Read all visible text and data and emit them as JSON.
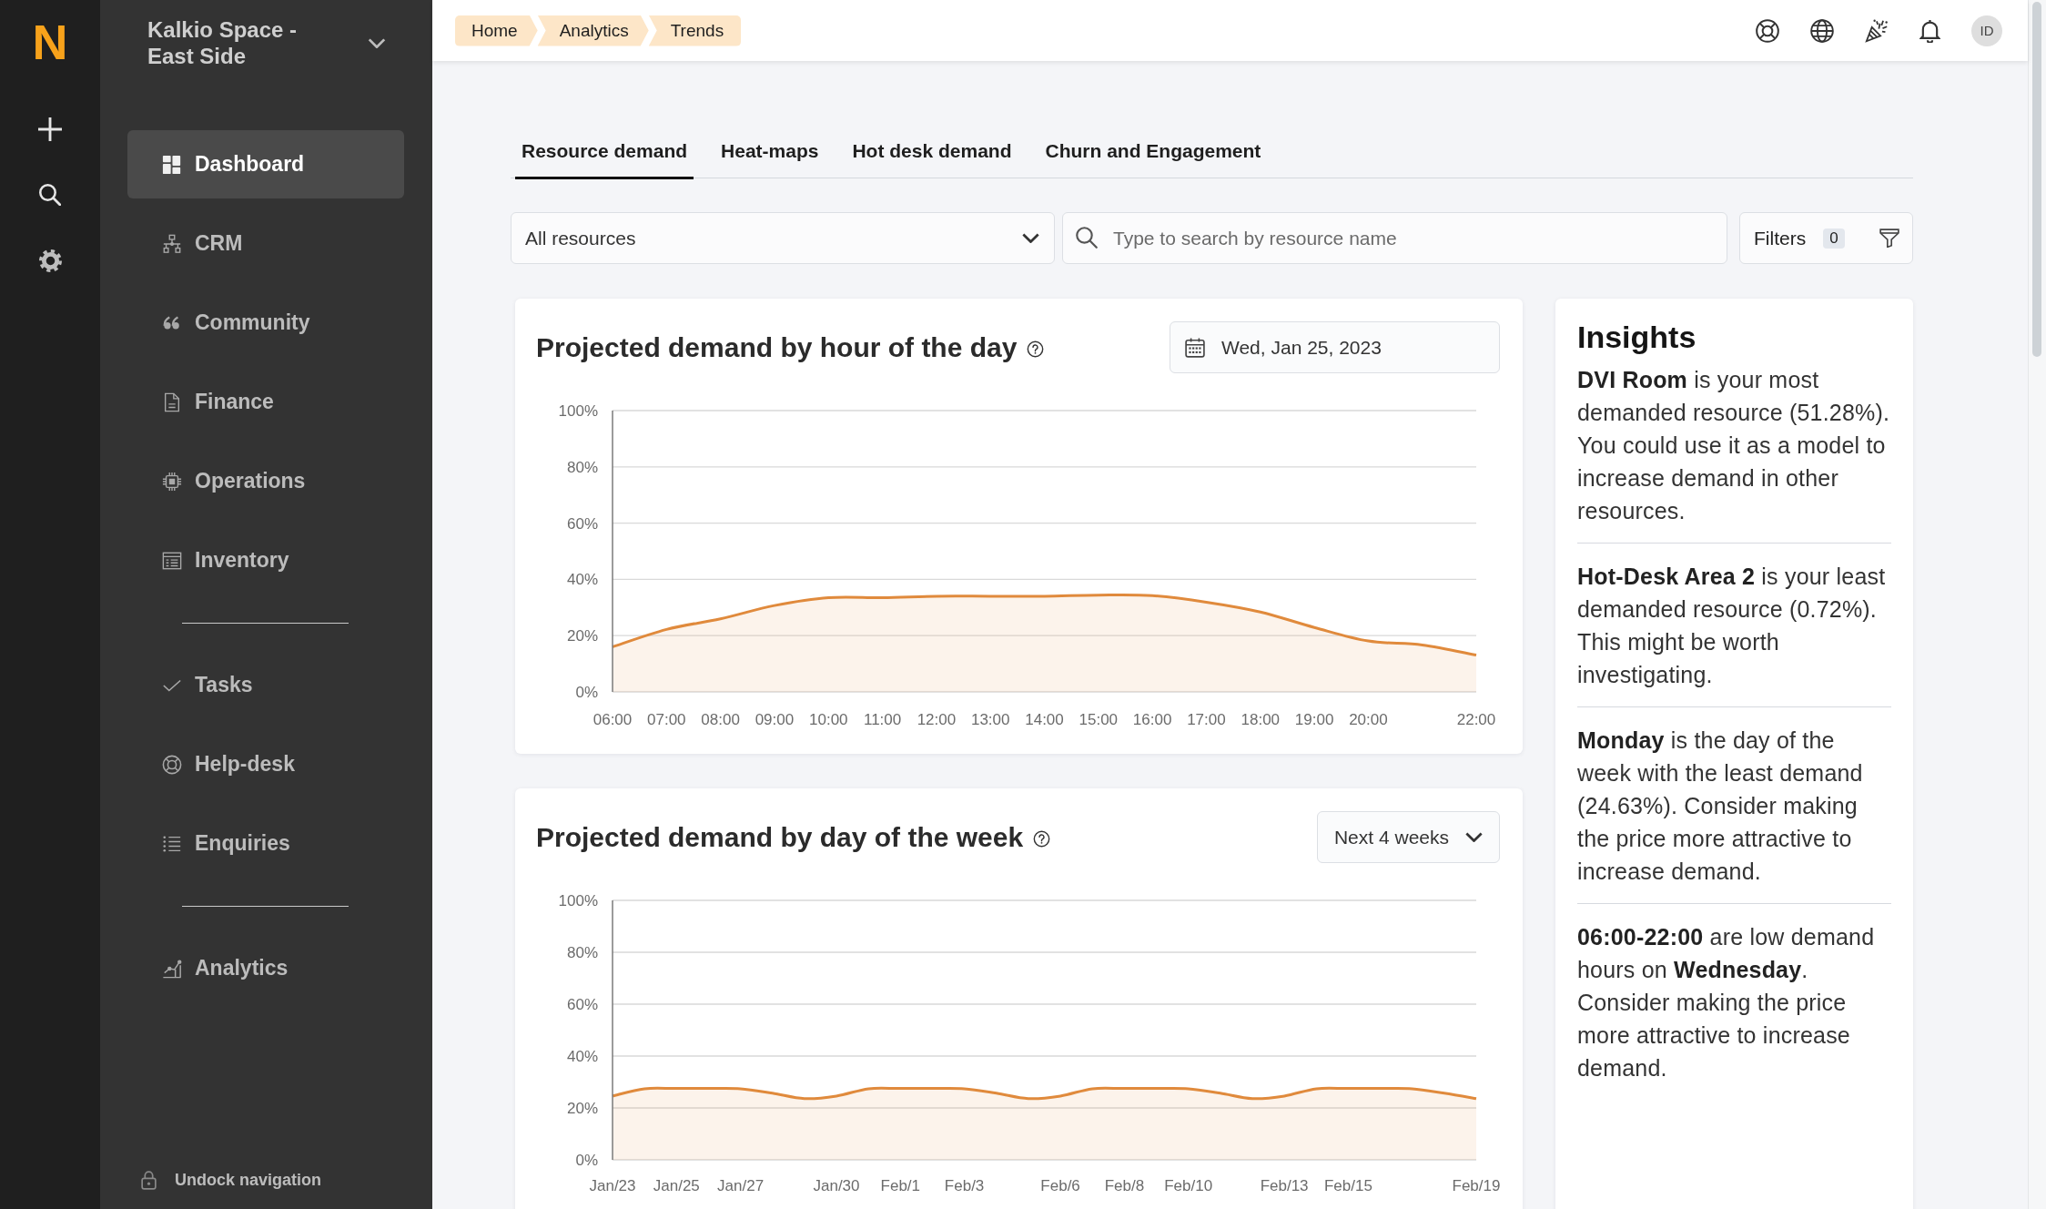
{
  "rail": {
    "logo": "N"
  },
  "sidebar": {
    "workspace": "Kalkio Space - East Side",
    "groups": [
      {
        "items": [
          {
            "label": "Dashboard",
            "selected": true
          },
          {
            "label": "CRM",
            "selected": false
          },
          {
            "label": "Community",
            "selected": false
          },
          {
            "label": "Finance",
            "selected": false
          },
          {
            "label": "Operations",
            "selected": false
          },
          {
            "label": "Inventory",
            "selected": false
          }
        ]
      },
      {
        "items": [
          {
            "label": "Tasks",
            "selected": false
          },
          {
            "label": "Help-desk",
            "selected": false
          },
          {
            "label": "Enquiries",
            "selected": false
          }
        ]
      },
      {
        "items": [
          {
            "label": "Analytics",
            "selected": false
          }
        ]
      }
    ],
    "undock": "Undock navigation"
  },
  "topbar": {
    "breadcrumbs": [
      "Home",
      "Analytics",
      "Trends"
    ],
    "avatar": "ID"
  },
  "tabs": [
    {
      "label": "Resource demand",
      "selected": true
    },
    {
      "label": "Heat-maps",
      "selected": false
    },
    {
      "label": "Hot desk demand",
      "selected": false
    },
    {
      "label": "Churn and Engagement",
      "selected": false
    }
  ],
  "toolbar": {
    "resource_select": {
      "value": "All resources"
    },
    "search": {
      "placeholder": "Type to search by resource name"
    },
    "filters": {
      "label": "Filters",
      "count": "0"
    }
  },
  "cards": [
    {
      "title": "Projected demand by hour of the day",
      "control": {
        "kind": "date",
        "value": "Wed, Jan 25, 2023"
      },
      "chart_data": {
        "type": "area",
        "x": [
          6,
          7,
          8,
          9,
          10,
          11,
          12,
          13,
          14,
          15,
          16,
          17,
          18,
          19,
          20,
          21,
          22
        ],
        "xlim": [
          6,
          22
        ],
        "ylim": [
          0,
          100
        ],
        "xticks": [
          {
            "value": 6,
            "label": "06:00"
          },
          {
            "value": 7,
            "label": "07:00"
          },
          {
            "value": 8,
            "label": "08:00"
          },
          {
            "value": 9,
            "label": "09:00"
          },
          {
            "value": 10,
            "label": "10:00"
          },
          {
            "value": 11,
            "label": "11:00"
          },
          {
            "value": 12,
            "label": "12:00"
          },
          {
            "value": 13,
            "label": "13:00"
          },
          {
            "value": 14,
            "label": "14:00"
          },
          {
            "value": 15,
            "label": "15:00"
          },
          {
            "value": 16,
            "label": "16:00"
          },
          {
            "value": 17,
            "label": "17:00"
          },
          {
            "value": 18,
            "label": "18:00"
          },
          {
            "value": 19,
            "label": "19:00"
          },
          {
            "value": 20,
            "label": "20:00"
          },
          {
            "value": 22,
            "label": "22:00"
          }
        ],
        "yticks": [
          {
            "value": 0,
            "label": "0%"
          },
          {
            "value": 20,
            "label": "20%"
          },
          {
            "value": 40,
            "label": "40%"
          },
          {
            "value": 60,
            "label": "60%"
          },
          {
            "value": 80,
            "label": "80%"
          },
          {
            "value": 100,
            "label": "100%"
          }
        ],
        "grid": true,
        "series": [
          {
            "color": "#e08a3c",
            "values": [
              16,
              22.2,
              26,
              30.7,
              33.5,
              33.5,
              34,
              34,
              34,
              34.4,
              34.2,
              31.9,
              28.4,
              22.9,
              18.1,
              16.7,
              13.1
            ]
          }
        ]
      }
    },
    {
      "title": "Projected demand by day of the week",
      "control": {
        "kind": "dropdown",
        "value": "Next 4 weeks"
      },
      "chart_data": {
        "type": "area",
        "categories": [
          "Jan/23",
          null,
          "Jan/25",
          null,
          "Jan/27",
          null,
          null,
          "Jan/30",
          null,
          "Feb/1",
          null,
          "Feb/3",
          null,
          null,
          "Feb/6",
          null,
          "Feb/8",
          null,
          "Feb/10",
          null,
          null,
          "Feb/13",
          null,
          "Feb/15",
          null,
          null,
          null,
          "Feb/19"
        ],
        "ylim": [
          0,
          100
        ],
        "yticks": [
          {
            "value": 0,
            "label": "0%"
          },
          {
            "value": 20,
            "label": "20%"
          },
          {
            "value": 40,
            "label": "40%"
          },
          {
            "value": 60,
            "label": "60%"
          },
          {
            "value": 80,
            "label": "80%"
          },
          {
            "value": 100,
            "label": "100%"
          }
        ],
        "grid": true,
        "series": [
          {
            "color": "#e08a3c",
            "values": [
              24.6,
              27.4,
              27.5,
              27.5,
              27.4,
              25.7,
              23.6,
              24.6,
              27.4,
              27.5,
              27.5,
              27.4,
              25.7,
              23.6,
              24.6,
              27.4,
              27.5,
              27.5,
              27.4,
              25.7,
              23.6,
              24.6,
              27.4,
              27.5,
              27.5,
              27.4,
              25.7,
              23.6
            ]
          }
        ]
      }
    }
  ],
  "insights": {
    "title": "Insights",
    "items": [
      "**DVI Room** is your most demanded resource (51.28%). You could use it as a model to increase demand in other resources.",
      "**Hot-Desk Area 2** is your least demanded resource (0.72%). This might be worth investigating.",
      "**Monday** is the day of the week with the least demand (24.63%). Consider making the price more attractive to increase demand.",
      "**06:00-22:00** are low demand hours on **Wednesday**. Consider making the price more attractive to increase demand."
    ]
  }
}
